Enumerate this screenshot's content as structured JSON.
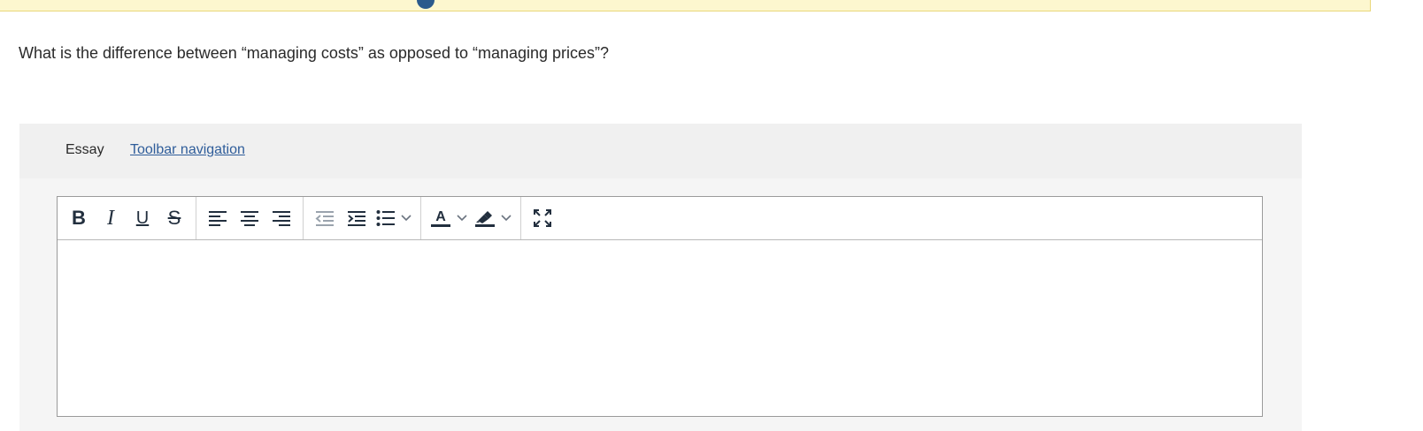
{
  "question": {
    "text": "What is the difference between “managing costs” as opposed to “managing prices”?"
  },
  "essay": {
    "label": "Essay",
    "toolbar_nav_link": "Toolbar navigation "
  },
  "toolbar": {
    "bold": "B",
    "italic": "I",
    "underline": "U",
    "strikethrough": "S",
    "icons": [
      "bold-icon",
      "italic-icon",
      "underline-icon",
      "strikethrough-icon",
      "align-left-icon",
      "align-center-icon",
      "align-right-icon",
      "outdent-icon",
      "indent-icon",
      "bullet-list-icon",
      "text-color-icon",
      "highlight-color-icon",
      "fullscreen-icon"
    ]
  },
  "colors": {
    "banner": "#fdf7cf",
    "link": "#2f5d9a",
    "panel": "#f5f5f5",
    "icon": "#222f3e"
  }
}
